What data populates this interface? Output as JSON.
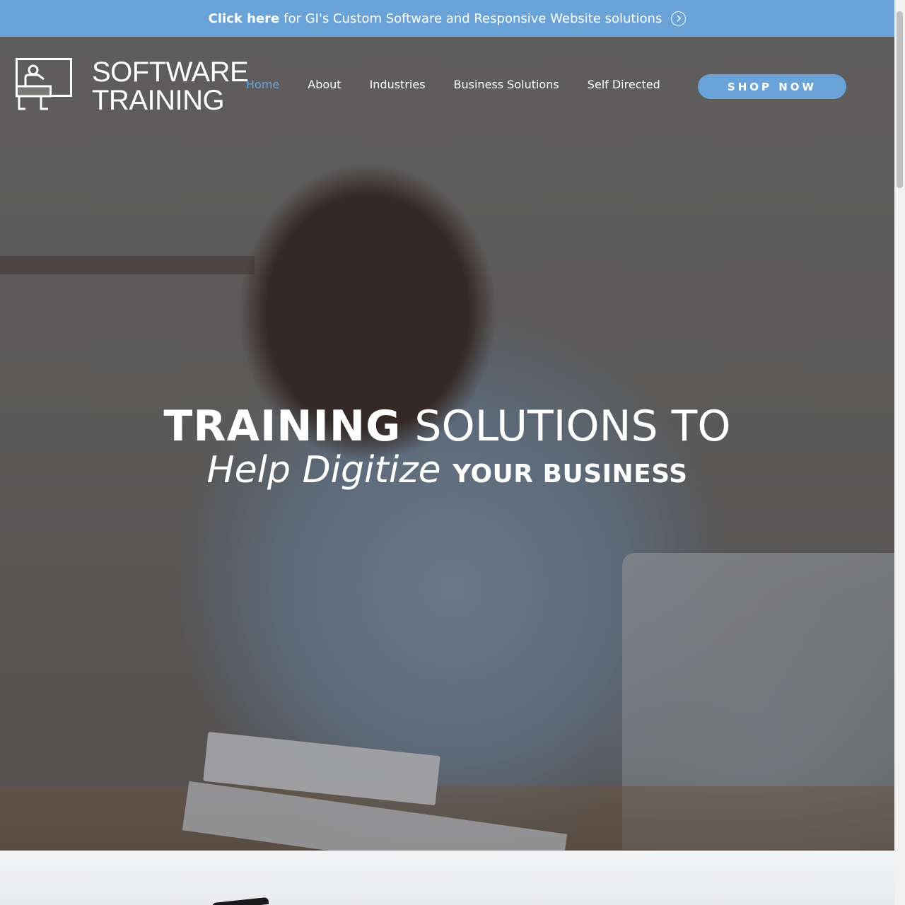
{
  "topbar": {
    "link_text": "Click here",
    "rest_text": "for GI's Custom Software and Responsive Website solutions",
    "icon": "circle-chevron-right-icon",
    "background": "#6aa3d8"
  },
  "logo": {
    "line1": "SOFTWARE",
    "line2": "TRAINING",
    "icon": "teacher-at-desk-icon"
  },
  "nav": {
    "items": [
      {
        "label": "Home",
        "active": true
      },
      {
        "label": "About",
        "active": false
      },
      {
        "label": "Industries",
        "active": false
      },
      {
        "label": "Business Solutions",
        "active": false
      },
      {
        "label": "Self Directed",
        "active": false
      }
    ],
    "active_color": "#6aa3d8"
  },
  "shop_button": {
    "label": "SHOP NOW",
    "color": "#6aa3d8"
  },
  "hero": {
    "headline_bold": "TRAINING",
    "headline_light": "SOLUTIONS TO",
    "subline_italic": "Help Digitize",
    "subline_bold": "YOUR BUSINESS",
    "image": "man-with-headset-writing-in-notebook"
  }
}
